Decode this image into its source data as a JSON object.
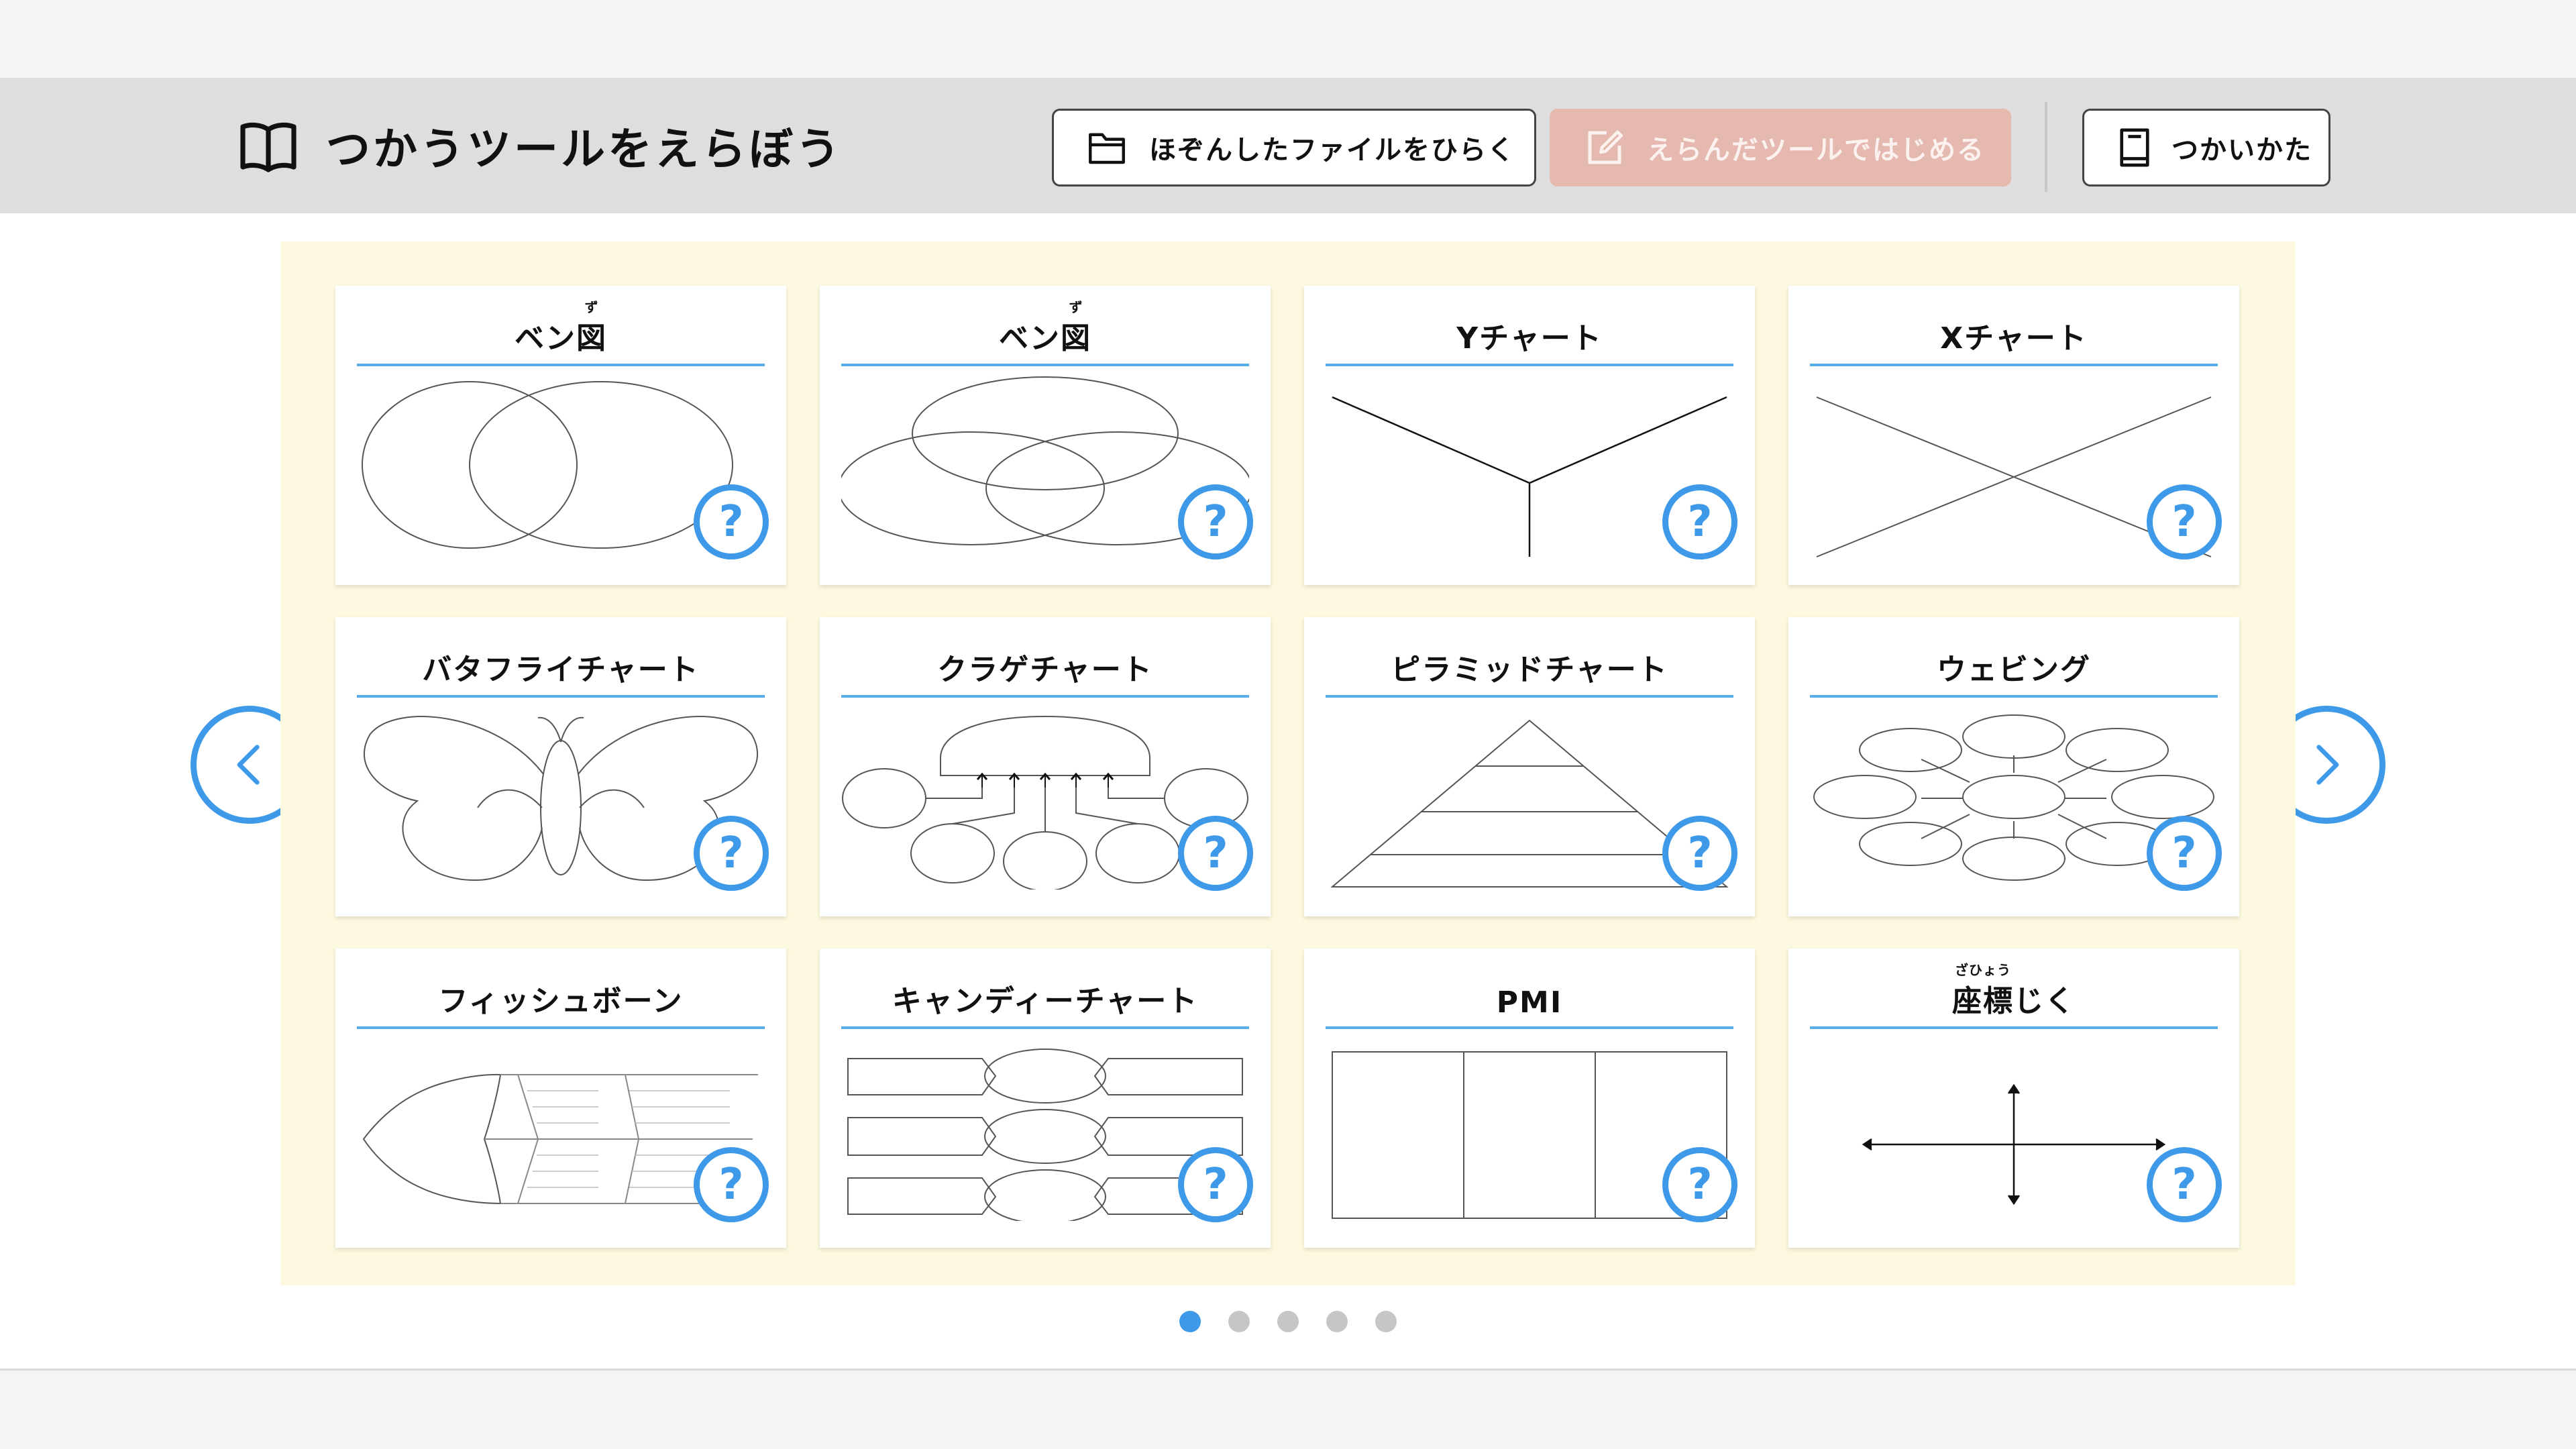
{
  "header": {
    "title": "つかうツールをえらぼう",
    "open_button": "ほぞんしたファイルをひらく",
    "start_button": "えらんだツールではじめる",
    "help_button": "つかいかた"
  },
  "colors": {
    "accent": "#3e9ae9",
    "panel": "#fdf9e0",
    "header": "#dedede",
    "disabled": "#e5b8b0"
  },
  "cards": [
    {
      "title_pre": "ベン",
      "title_ruby_base": "図",
      "title_ruby": "ず",
      "title_post": "",
      "diagram": "venn-2"
    },
    {
      "title_pre": "ベン",
      "title_ruby_base": "図",
      "title_ruby": "ず",
      "title_post": "",
      "diagram": "venn-3"
    },
    {
      "title_pre": "Yチャート",
      "title_ruby_base": "",
      "title_ruby": "",
      "title_post": "",
      "diagram": "y-chart"
    },
    {
      "title_pre": "Xチャート",
      "title_ruby_base": "",
      "title_ruby": "",
      "title_post": "",
      "diagram": "x-chart"
    },
    {
      "title_pre": "バタフライチャート",
      "title_ruby_base": "",
      "title_ruby": "",
      "title_post": "",
      "diagram": "butterfly"
    },
    {
      "title_pre": "クラゲチャート",
      "title_ruby_base": "",
      "title_ruby": "",
      "title_post": "",
      "diagram": "jellyfish"
    },
    {
      "title_pre": "ピラミッドチャート",
      "title_ruby_base": "",
      "title_ruby": "",
      "title_post": "",
      "diagram": "pyramid"
    },
    {
      "title_pre": "ウェビング",
      "title_ruby_base": "",
      "title_ruby": "",
      "title_post": "",
      "diagram": "webbing"
    },
    {
      "title_pre": "フィッシュボーン",
      "title_ruby_base": "",
      "title_ruby": "",
      "title_post": "",
      "diagram": "fishbone"
    },
    {
      "title_pre": "キャンディーチャート",
      "title_ruby_base": "",
      "title_ruby": "",
      "title_post": "",
      "diagram": "candy"
    },
    {
      "title_pre": "PMI",
      "title_ruby_base": "",
      "title_ruby": "",
      "title_post": "",
      "diagram": "pmi"
    },
    {
      "title_pre": "",
      "title_ruby_base": "座標",
      "title_ruby": "ざひょう",
      "title_post": "じく",
      "diagram": "axes"
    }
  ],
  "help_mark": "?",
  "pagination": {
    "pages": 5,
    "current": 1
  },
  "icons": {
    "title": "book-icon",
    "open": "folder-icon",
    "start": "edit-icon",
    "help": "manual-icon",
    "prev": "chevron-left-icon",
    "next": "chevron-right-icon"
  }
}
